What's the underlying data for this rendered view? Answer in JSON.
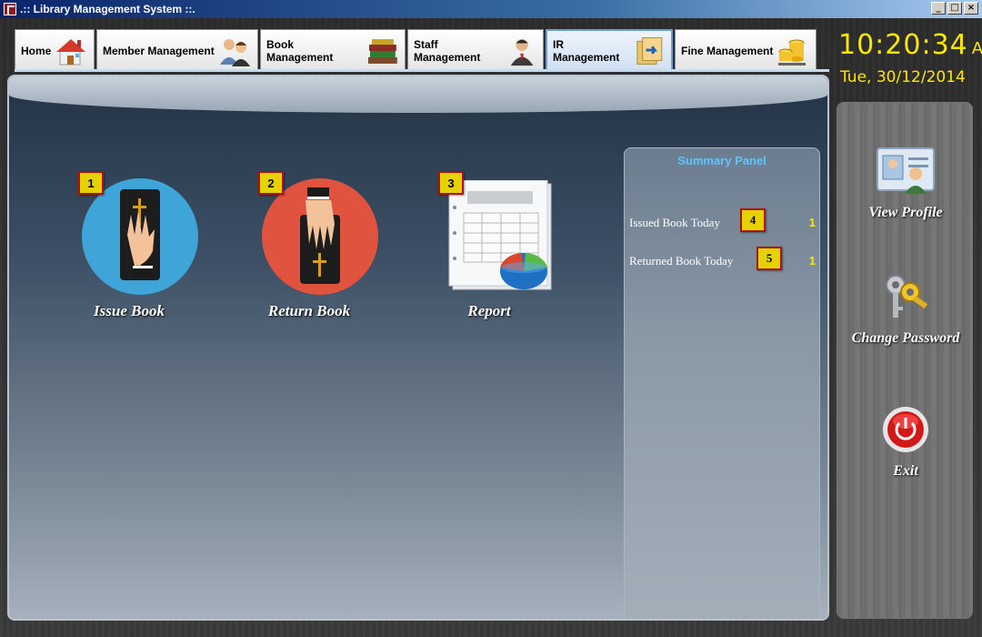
{
  "window": {
    "title": ".:: Library Management System ::.",
    "controls": {
      "minimize": "_",
      "maximize": "□",
      "close": "×"
    }
  },
  "tabs": [
    {
      "label": "Home",
      "icon": "house-icon"
    },
    {
      "label": "Member Management",
      "icon": "members-icon"
    },
    {
      "label": "Book Management",
      "icon": "books-icon"
    },
    {
      "label": "Staff Management",
      "icon": "staff-icon"
    },
    {
      "label": "IR Management",
      "icon": "ir-icon",
      "active": true
    },
    {
      "label": "Fine Management",
      "icon": "coins-icon"
    }
  ],
  "clock": {
    "time": "10:20:34",
    "ampm": "AM",
    "date": "Tue, 30/12/2014"
  },
  "features": [
    {
      "badge": "1",
      "label": "Issue Book",
      "icon": "issue-book-icon",
      "color": "#3fa4d8"
    },
    {
      "badge": "2",
      "label": "Return Book",
      "icon": "return-book-icon",
      "color": "#e0533f"
    },
    {
      "badge": "3",
      "label": "Report",
      "icon": "report-icon"
    }
  ],
  "summary": {
    "title": "Summary Panel",
    "rows": [
      {
        "label": "Issued Book Today",
        "badge": "4",
        "value": "1"
      },
      {
        "label": "Returned Book Today",
        "badge": "5",
        "value": "1"
      }
    ]
  },
  "sidebar": {
    "items": [
      {
        "label": "View Profile",
        "icon": "profile-card-icon"
      },
      {
        "label": "Change Password",
        "icon": "keys-icon"
      },
      {
        "label": "Exit",
        "icon": "power-icon"
      }
    ]
  },
  "colors": {
    "accent": "#ffe600",
    "badge_border": "#b01010",
    "summary_title": "#5fc4ff"
  }
}
